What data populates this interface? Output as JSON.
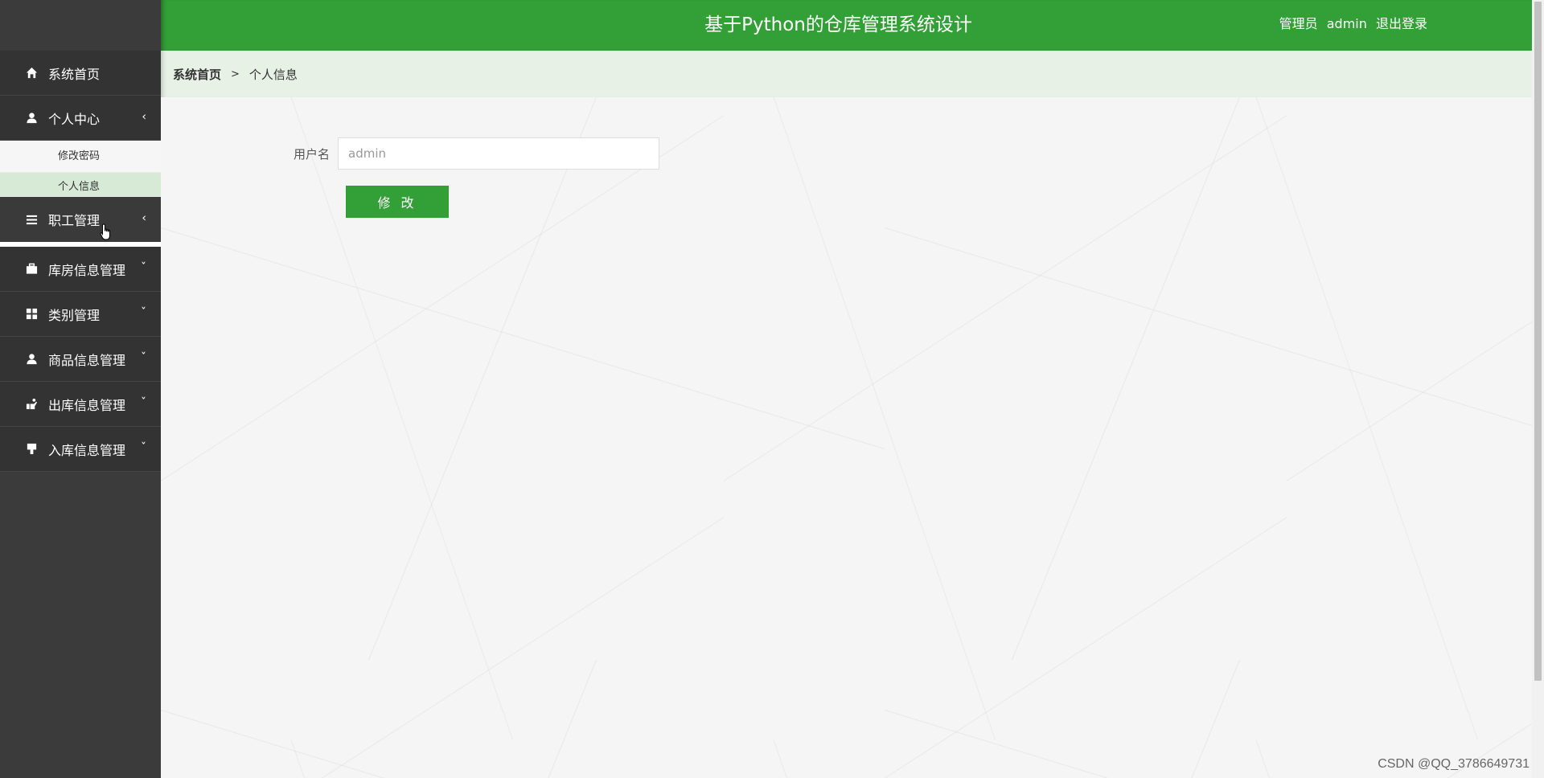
{
  "header": {
    "title": "基于Python的仓库管理系统设计",
    "user_role": "管理员",
    "username": "admin",
    "logout": "退出登录"
  },
  "breadcrumb": {
    "home": "系统首页",
    "separator": ">",
    "current": "个人信息"
  },
  "sidebar": {
    "items": [
      {
        "label": "系统首页",
        "icon": "home-icon"
      },
      {
        "label": "个人中心",
        "icon": "user-icon",
        "arrow": "‹",
        "children": [
          {
            "label": "修改密码"
          },
          {
            "label": "个人信息"
          }
        ]
      },
      {
        "label": "职工管理",
        "icon": "list-icon",
        "arrow": "‹"
      },
      {
        "label": "库房信息管理",
        "icon": "briefcase-icon",
        "arrow": "ˇ"
      },
      {
        "label": "类别管理",
        "icon": "grid-icon",
        "arrow": "ˇ"
      },
      {
        "label": "商品信息管理",
        "icon": "user-icon",
        "arrow": "ˇ"
      },
      {
        "label": "出库信息管理",
        "icon": "hand-icon",
        "arrow": "ˇ"
      },
      {
        "label": "入库信息管理",
        "icon": "flag-icon",
        "arrow": "ˇ"
      }
    ]
  },
  "form": {
    "username_label": "用户名",
    "username_value": "admin",
    "submit_label": "修 改"
  },
  "watermark": "CSDN @QQ_3786649731",
  "colors": {
    "primary": "#32a036",
    "sidebar": "#333333",
    "breadcrumb_bg": "#e7f1e6"
  }
}
